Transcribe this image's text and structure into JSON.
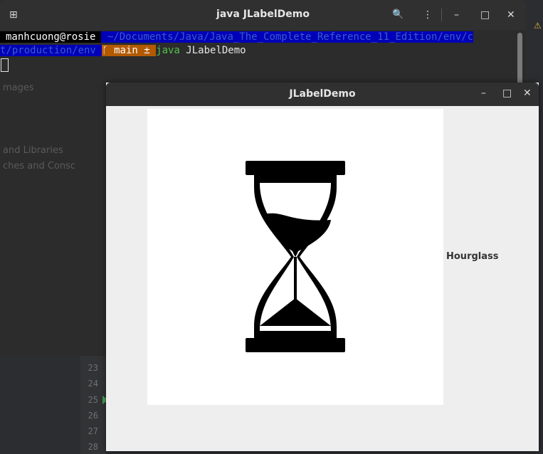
{
  "terminal": {
    "title": "java JLabelDemo",
    "user": "manhcuong@rosie",
    "path_line1": " ~/Documents/Java/Java_The_Complete_Reference_11_Edition/env/c",
    "path_line2": "t/production/env ",
    "branch": " ᚴ main ± ",
    "cmd_java": "java",
    "cmd_arg": "JLabelDemo",
    "buttons": {
      "new_tab": "⊞",
      "search": "🔍",
      "menu": "⋮",
      "minimize": "–",
      "maximize": "□",
      "close": "✕"
    }
  },
  "ide": {
    "faint_texts": [
      "mages",
      "and Libraries",
      "ches and Consc"
    ],
    "line_numbers": [
      "23",
      "24",
      "25",
      "26",
      "27",
      "28"
    ],
    "warning": "⚠"
  },
  "jwindow": {
    "title": "JLabelDemo",
    "label": "Hourglass",
    "icon": "hourglass-icon",
    "buttons": {
      "minimize": "–",
      "maximize": "□",
      "close": "✕"
    }
  }
}
